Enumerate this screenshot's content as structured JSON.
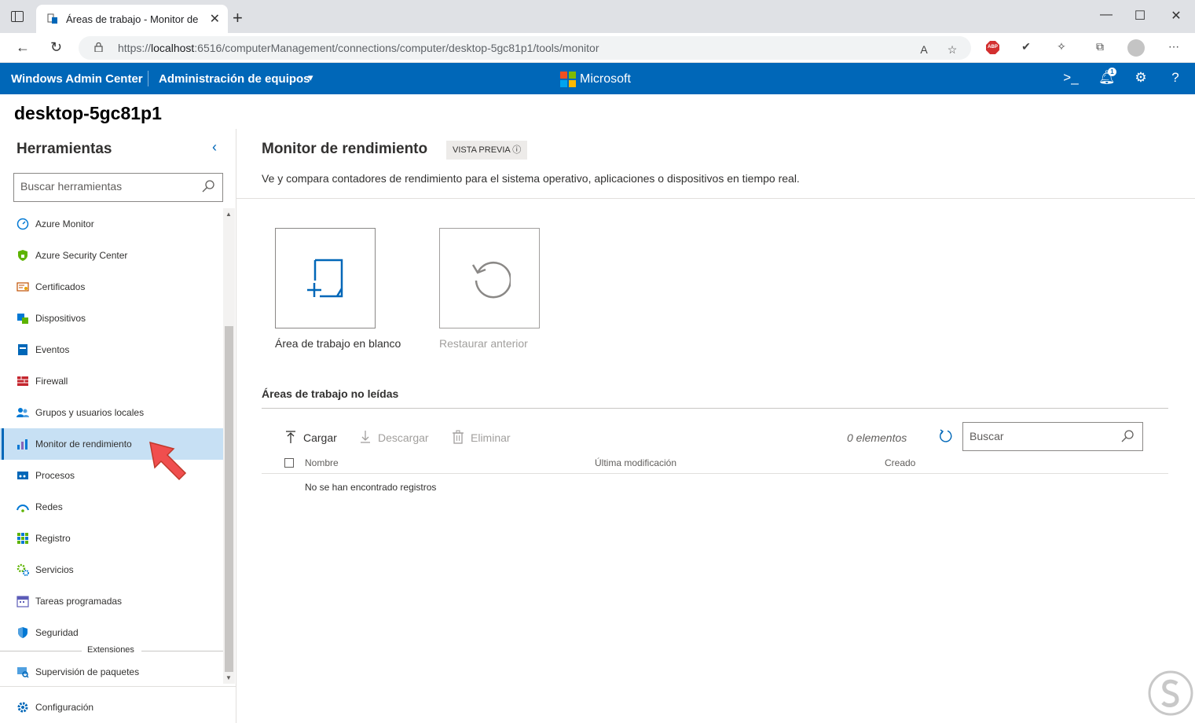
{
  "browser": {
    "tab_title": "Áreas de trabajo - Monitor de re",
    "tab_close": "✕",
    "new_tab": "+",
    "url_prefix": "https://",
    "url_host": "localhost",
    "url_rest": ":6516/computerManagement/connections/computer/desktop-5gc81p1/tools/monitor",
    "abp_label": "ABP",
    "win_minimize": "—",
    "win_maximize": "☐",
    "win_close": "✕"
  },
  "header": {
    "brand": "Windows Admin Center",
    "context": "Administración de equipos",
    "vendor": "Microsoft",
    "notification_count": "1",
    "colors": {
      "bar": "#0067b8"
    }
  },
  "server_name": "desktop-5gc81p1",
  "sidebar": {
    "title": "Herramientas",
    "search_placeholder": "Buscar herramientas",
    "items": [
      {
        "label": "Azure Monitor",
        "icon": "azure-monitor-icon"
      },
      {
        "label": "Azure Security Center",
        "icon": "shield-lock-icon"
      },
      {
        "label": "Certificados",
        "icon": "certificate-icon"
      },
      {
        "label": "Dispositivos",
        "icon": "devices-icon"
      },
      {
        "label": "Eventos",
        "icon": "events-icon"
      },
      {
        "label": "Firewall",
        "icon": "firewall-icon"
      },
      {
        "label": "Grupos y usuarios locales",
        "icon": "users-icon"
      },
      {
        "label": "Monitor de rendimiento",
        "icon": "chart-icon",
        "active": true
      },
      {
        "label": "Procesos",
        "icon": "processes-icon"
      },
      {
        "label": "Redes",
        "icon": "network-icon"
      },
      {
        "label": "Registro",
        "icon": "registry-icon"
      },
      {
        "label": "Servicios",
        "icon": "services-icon"
      },
      {
        "label": "Tareas programadas",
        "icon": "calendar-icon"
      },
      {
        "label": "Seguridad",
        "icon": "security-shield-icon"
      }
    ],
    "extensions_label": "Extensiones",
    "extension_items": [
      {
        "label": "Supervisión de paquetes",
        "icon": "package-monitor-icon"
      }
    ],
    "settings_label": "Configuración"
  },
  "main": {
    "title": "Monitor de rendimiento",
    "badge": "VISTA PREVIA ⓘ",
    "description": "Ve y compara contadores de rendimiento para el sistema operativo, aplicaciones o dispositivos en tiempo real.",
    "tiles": [
      {
        "label": "Área de trabajo en blanco",
        "enabled": true
      },
      {
        "label": "Restaurar anterior",
        "enabled": false
      }
    ],
    "section_title": "Áreas de trabajo no leídas",
    "commands": {
      "upload": "Cargar",
      "download": "Descargar",
      "delete": "Eliminar"
    },
    "item_count": "0 elementos",
    "search_placeholder": "Buscar",
    "columns": [
      "Nombre",
      "Última modificación",
      "Creado"
    ],
    "empty_message": "No se han encontrado registros"
  }
}
